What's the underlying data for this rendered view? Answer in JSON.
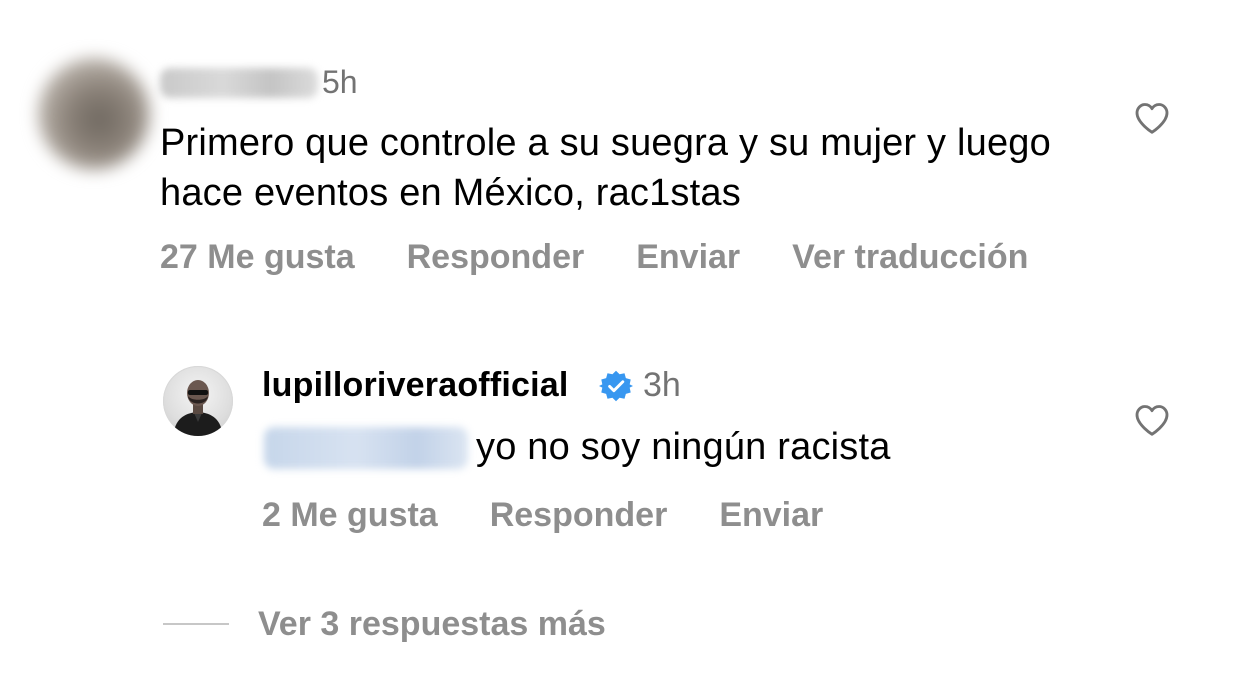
{
  "comment": {
    "time": "5h",
    "text": "Primero que controle a su suegra y su mujer y luego hace eventos en México, rac1stas",
    "actions": {
      "likes": "27 Me gusta",
      "reply": "Responder",
      "send": "Enviar",
      "translate": "Ver traducción"
    },
    "like_icon": "heart-icon"
  },
  "reply": {
    "username": "lupilloriveraofficial",
    "verified_icon": "verified-badge-icon",
    "time": "3h",
    "text": "yo no soy ningún racista",
    "actions": {
      "likes": "2 Me gusta",
      "reply": "Responder",
      "send": "Enviar"
    },
    "like_icon": "heart-icon"
  },
  "more_replies": "Ver 3 respuestas más",
  "colors": {
    "text": "#000000",
    "secondary": "#8e8e8e",
    "timestamp": "#737373",
    "verified": "#3897f0",
    "divider": "#c7c7c7"
  }
}
